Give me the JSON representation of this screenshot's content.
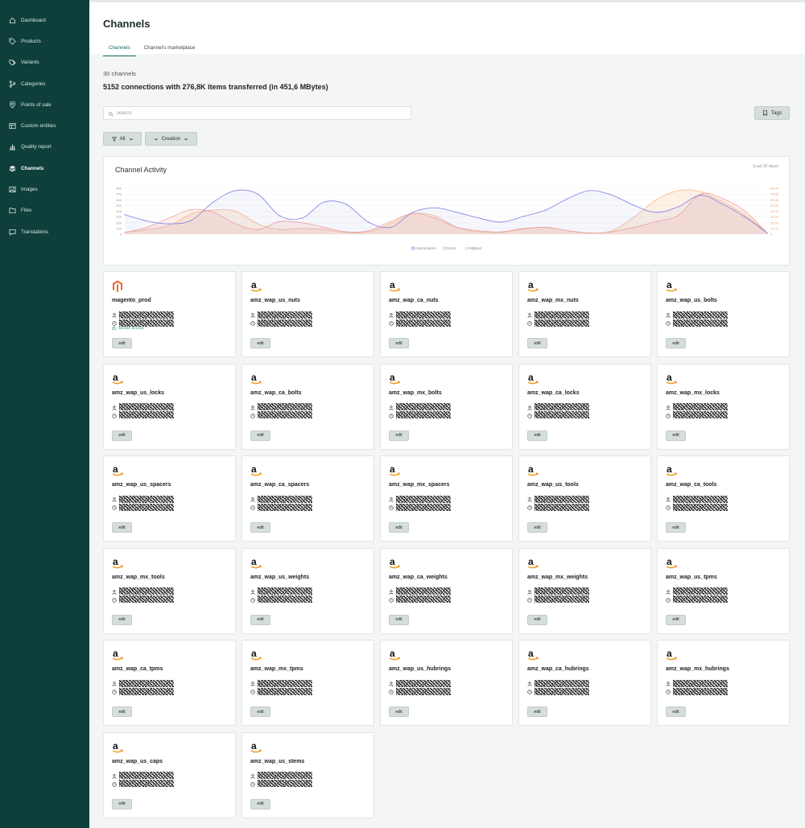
{
  "sidebar": {
    "items": [
      {
        "label": "Dashboard",
        "icon": "home-icon",
        "active": false
      },
      {
        "label": "Products",
        "icon": "tag-icon",
        "active": false
      },
      {
        "label": "Variants",
        "icon": "tags-icon",
        "active": false
      },
      {
        "label": "Categories",
        "icon": "branch-icon",
        "active": false
      },
      {
        "label": "Points of sale",
        "icon": "map-pin-icon",
        "active": false
      },
      {
        "label": "Custom entities",
        "icon": "grid-icon",
        "active": false
      },
      {
        "label": "Quality report",
        "icon": "bar-chart-icon",
        "active": false
      },
      {
        "label": "Channels",
        "icon": "layers-icon",
        "active": true
      },
      {
        "label": "Images",
        "icon": "image-icon",
        "active": false
      },
      {
        "label": "Files",
        "icon": "folder-icon",
        "active": false
      },
      {
        "label": "Translations",
        "icon": "message-icon",
        "active": false
      }
    ]
  },
  "header": {
    "title": "Channels",
    "tabs": [
      {
        "label": "Channels",
        "active": true
      },
      {
        "label": "Channel's marketplace",
        "active": false
      }
    ]
  },
  "main": {
    "count_text": "30 channels",
    "summary_text": "5152 connections with 276,8K items transferred (in 451,6 MBytes)",
    "search_placeholder": "search",
    "tags_label": "Tags",
    "filter_all_label": "All",
    "filter_creation_label": "Creation"
  },
  "chart": {
    "title": "Channel Activity",
    "range_label": "(Last 30 days)",
    "legend": [
      "Connections",
      "Items",
      "MBytes"
    ],
    "y_left_ticks": [
      "800",
      "700",
      "600",
      "500",
      "400",
      "300",
      "200",
      "100",
      "0"
    ],
    "y_right_ticks": [
      "80.00",
      "70.00",
      "60.00",
      "50.00",
      "40.00",
      "30.00",
      "20.00",
      "10.00",
      "0"
    ],
    "colors": {
      "connections": "#7d7fe0",
      "items": "#f4a49a",
      "mbytes": "#f7c9a0"
    }
  },
  "chart_data": {
    "type": "line",
    "title": "Channel Activity",
    "subtitle": "(Last 30 days)",
    "x": [
      0,
      1,
      2,
      3,
      4,
      5,
      6,
      7,
      8,
      9,
      10,
      11,
      12,
      13,
      14,
      15,
      16,
      17,
      18,
      19,
      20,
      21,
      22,
      23,
      24,
      25,
      26,
      27,
      28,
      29
    ],
    "ylim": [
      0,
      800
    ],
    "y2lim": [
      0,
      80
    ],
    "legend_position": "bottom",
    "series": [
      {
        "name": "Connections",
        "axis": "left",
        "values": [
          340,
          230,
          180,
          240,
          560,
          760,
          700,
          320,
          280,
          560,
          520,
          210,
          120,
          380,
          460,
          380,
          280,
          210,
          310,
          420,
          620,
          760,
          680,
          500,
          380,
          480,
          680,
          520,
          300,
          20
        ]
      },
      {
        "name": "Items",
        "axis": "left",
        "values": [
          30,
          120,
          280,
          430,
          380,
          180,
          80,
          220,
          200,
          120,
          40,
          60,
          220,
          360,
          280,
          120,
          60,
          40,
          100,
          120,
          60,
          20,
          40,
          120,
          220,
          330,
          700,
          620,
          400,
          20
        ]
      },
      {
        "name": "MBytes",
        "axis": "right",
        "values": [
          3,
          8,
          15,
          35,
          42,
          40,
          18,
          8,
          10,
          8,
          3,
          4,
          18,
          36,
          32,
          12,
          4,
          3,
          9,
          12,
          6,
          2,
          6,
          30,
          60,
          76,
          74,
          56,
          34,
          2
        ]
      }
    ]
  },
  "channels": [
    {
      "name": "magento_prod",
      "logo": "magento-logo",
      "secure": true,
      "secure_label": "Secure access",
      "edit_label": "edit"
    },
    {
      "name": "amz_wap_us_nuts",
      "logo": "amazon-logo",
      "edit_label": "edit"
    },
    {
      "name": "amz_wap_ca_nuts",
      "logo": "amazon-logo",
      "edit_label": "edit"
    },
    {
      "name": "amz_wap_mx_nuts",
      "logo": "amazon-logo",
      "edit_label": "edit"
    },
    {
      "name": "amz_wap_us_bolts",
      "logo": "amazon-logo",
      "edit_label": "edit"
    },
    {
      "name": "amz_wap_us_locks",
      "logo": "amazon-logo",
      "edit_label": "edit"
    },
    {
      "name": "amz_wap_ca_bolts",
      "logo": "amazon-logo",
      "edit_label": "edit"
    },
    {
      "name": "amz_wap_mx_bolts",
      "logo": "amazon-logo",
      "edit_label": "edit"
    },
    {
      "name": "amz_wap_ca_locks",
      "logo": "amazon-logo",
      "edit_label": "edit"
    },
    {
      "name": "amz_wap_mx_locks",
      "logo": "amazon-logo",
      "edit_label": "edit"
    },
    {
      "name": "amz_wap_us_spacers",
      "logo": "amazon-logo",
      "edit_label": "edit"
    },
    {
      "name": "amz_wap_ca_spacers",
      "logo": "amazon-logo",
      "edit_label": "edit"
    },
    {
      "name": "amz_wap_mx_spacers",
      "logo": "amazon-logo",
      "edit_label": "edit"
    },
    {
      "name": "amz_wap_us_tools",
      "logo": "amazon-logo",
      "edit_label": "edit"
    },
    {
      "name": "amz_wap_ca_tools",
      "logo": "amazon-logo",
      "edit_label": "edit"
    },
    {
      "name": "amz_wap_mx_tools",
      "logo": "amazon-logo",
      "edit_label": "edit"
    },
    {
      "name": "amz_wap_us_weights",
      "logo": "amazon-logo",
      "edit_label": "edit"
    },
    {
      "name": "amz_wap_ca_weights",
      "logo": "amazon-logo",
      "edit_label": "edit"
    },
    {
      "name": "amz_wap_mx_weights",
      "logo": "amazon-logo",
      "edit_label": "edit"
    },
    {
      "name": "amz_wap_us_tpms",
      "logo": "amazon-logo",
      "edit_label": "edit"
    },
    {
      "name": "amz_wap_ca_tpms",
      "logo": "amazon-logo",
      "edit_label": "edit"
    },
    {
      "name": "amz_wap_mx_tpms",
      "logo": "amazon-logo",
      "edit_label": "edit"
    },
    {
      "name": "amz_wap_us_hubrings",
      "logo": "amazon-logo",
      "edit_label": "edit"
    },
    {
      "name": "amz_wap_ca_hubrings",
      "logo": "amazon-logo",
      "edit_label": "edit"
    },
    {
      "name": "amz_wap_mx_hubrings",
      "logo": "amazon-logo",
      "edit_label": "edit"
    },
    {
      "name": "amz_wap_us_caps",
      "logo": "amazon-logo",
      "edit_label": "edit"
    },
    {
      "name": "amz_wap_us_stems",
      "logo": "amazon-logo",
      "edit_label": "edit"
    }
  ]
}
